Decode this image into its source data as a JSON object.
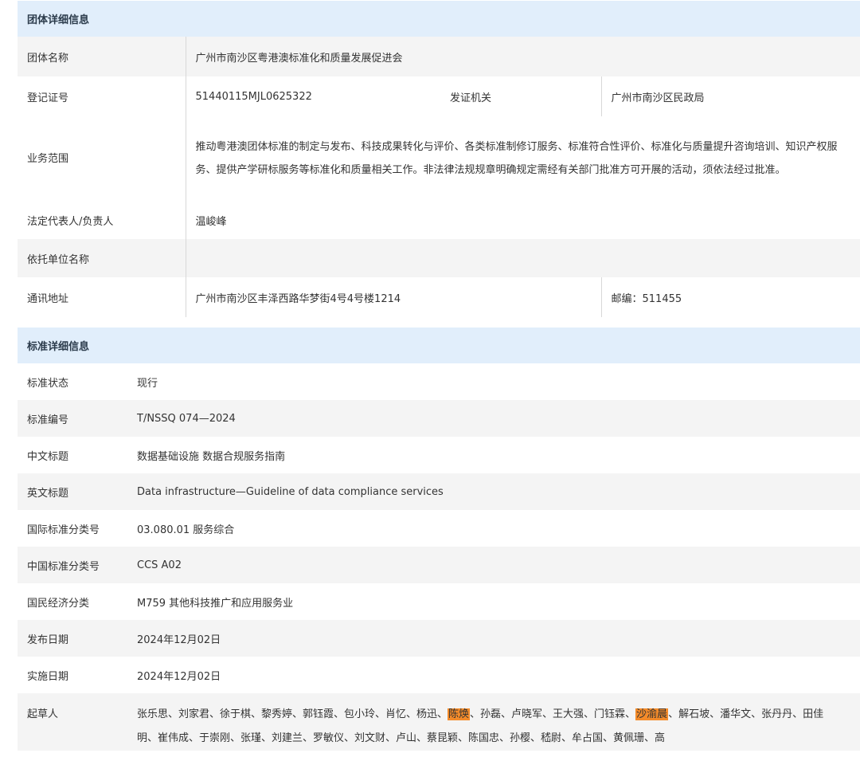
{
  "group_info": {
    "header": "团体详细信息",
    "name_label": "团体名称",
    "name_value": "广州市南沙区粤港澳标准化和质量发展促进会",
    "reg_label": "登记证号",
    "reg_value": "51440115MJL0625322",
    "issuer_label": "发证机关",
    "issuer_value": "广州市南沙区民政局",
    "scope_label": "业务范围",
    "scope_value": "推动粤港澳团体标准的制定与发布、科技成果转化与评价、各类标准制修订服务、标准符合性评价、标准化与质量提升咨询培训、知识产权服务、提供产学研标服务等标准化和质量相关工作。非法律法规规章明确规定需经有关部门批准方可开展的活动，须依法经过批准。",
    "legal_rep_label": "法定代表人/负责人",
    "legal_rep_value": "温峻峰",
    "parent_org_label": "依托单位名称",
    "parent_org_value": "",
    "address_label": "通讯地址",
    "address_value": "广州市南沙区丰泽西路华梦街4号4号楼1214",
    "postcode_text": "邮编：511455"
  },
  "standard_info": {
    "header": "标准详细信息",
    "rows": [
      {
        "label": "标准状态",
        "value": "现行"
      },
      {
        "label": "标准编号",
        "value": "T/NSSQ 074—2024"
      },
      {
        "label": "中文标题",
        "value": "数据基础设施 数据合规服务指南"
      },
      {
        "label": "英文标题",
        "value": "Data infrastructure—Guideline of data compliance services"
      },
      {
        "label": "国际标准分类号",
        "value": "03.080.01 服务综合"
      },
      {
        "label": "中国标准分类号",
        "value": "CCS A02"
      },
      {
        "label": "国民经济分类",
        "value": "M759 其他科技推广和应用服务业"
      },
      {
        "label": "发布日期",
        "value": "2024年12月02日"
      },
      {
        "label": "实施日期",
        "value": "2024年12月02日"
      }
    ],
    "drafters_label": "起草人",
    "drafters_part1": "张乐思、刘家君、徐于棋、黎秀婷、郭钰霞、包小玲、肖忆、杨迅、",
    "drafters_highlight1": "陈焕",
    "drafters_part2": "、孙磊、卢晓军、王大强、门钰霖、",
    "drafters_highlight2": "沙渝晨",
    "drafters_part3": "、解石坡、潘华文、张丹丹、田佳明、崔伟成、于崇刚、张瑾、刘建兰、罗敏仪、刘文财、卢山、蔡昆颖、陈国忠、孙樱、嵇尉、牟占国、黄佩珊、高"
  },
  "colors": {
    "header_bg": "#e1eefb",
    "alt_row_bg": "#f4f4f4",
    "highlight": "#f48b2a"
  }
}
